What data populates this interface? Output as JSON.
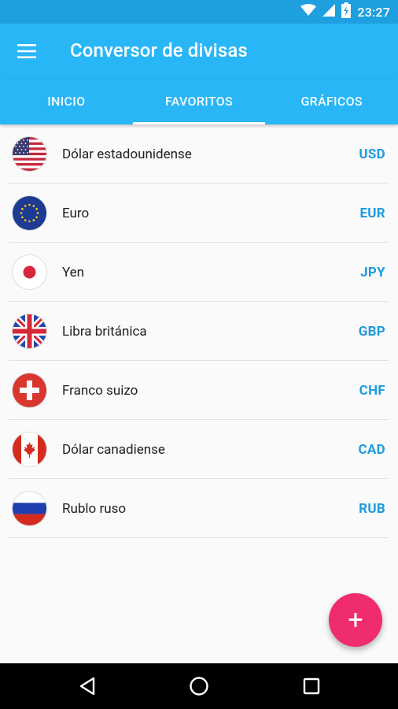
{
  "status_bar": {
    "time": "23:27",
    "icons": [
      "wifi-icon",
      "signal-icon",
      "battery-charging-icon"
    ]
  },
  "app_bar": {
    "menu_icon": "hamburger-menu-icon",
    "title": "Conversor de divisas"
  },
  "tabs": [
    {
      "label": "INICIO",
      "active": false
    },
    {
      "label": "FAVORITOS",
      "active": true
    },
    {
      "label": "GRÁFICOS",
      "active": false
    }
  ],
  "currencies": [
    {
      "name": "Dólar estadounidense",
      "code": "USD",
      "flag": "us-flag-icon"
    },
    {
      "name": "Euro",
      "code": "EUR",
      "flag": "eu-flag-icon"
    },
    {
      "name": "Yen",
      "code": "JPY",
      "flag": "japan-flag-icon"
    },
    {
      "name": "Libra británica",
      "code": "GBP",
      "flag": "uk-flag-icon"
    },
    {
      "name": "Franco suizo",
      "code": "CHF",
      "flag": "switzerland-flag-icon"
    },
    {
      "name": "Dólar canadiense",
      "code": "CAD",
      "flag": "canada-flag-icon"
    },
    {
      "name": "Rublo ruso",
      "code": "RUB",
      "flag": "russia-flag-icon"
    }
  ],
  "fab": {
    "icon": "plus-icon",
    "symbol": "+"
  },
  "nav_bar": {
    "buttons": [
      "back-icon",
      "home-icon",
      "recents-icon"
    ]
  },
  "colors": {
    "primary": "#29b6f6",
    "status_bar": "#1e9fe0",
    "accent": "#ef2c6d",
    "currency_code": "#1e9ae0"
  }
}
